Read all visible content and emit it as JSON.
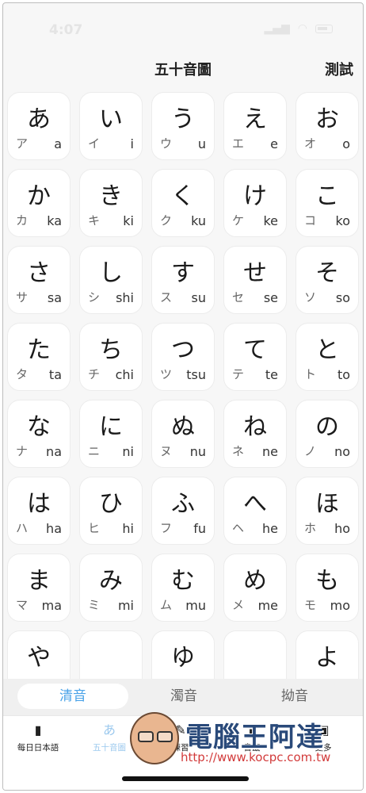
{
  "status_bar": {
    "time": "4:07"
  },
  "nav": {
    "title": "五十音圖",
    "test_button": "測試"
  },
  "kana_rows": [
    [
      {
        "hira": "あ",
        "kata": "ア",
        "roma": "a"
      },
      {
        "hira": "い",
        "kata": "イ",
        "roma": "i"
      },
      {
        "hira": "う",
        "kata": "ウ",
        "roma": "u"
      },
      {
        "hira": "え",
        "kata": "エ",
        "roma": "e"
      },
      {
        "hira": "お",
        "kata": "オ",
        "roma": "o"
      }
    ],
    [
      {
        "hira": "か",
        "kata": "カ",
        "roma": "ka"
      },
      {
        "hira": "き",
        "kata": "キ",
        "roma": "ki"
      },
      {
        "hira": "く",
        "kata": "ク",
        "roma": "ku"
      },
      {
        "hira": "け",
        "kata": "ケ",
        "roma": "ke"
      },
      {
        "hira": "こ",
        "kata": "コ",
        "roma": "ko"
      }
    ],
    [
      {
        "hira": "さ",
        "kata": "サ",
        "roma": "sa"
      },
      {
        "hira": "し",
        "kata": "シ",
        "roma": "shi"
      },
      {
        "hira": "す",
        "kata": "ス",
        "roma": "su"
      },
      {
        "hira": "せ",
        "kata": "セ",
        "roma": "se"
      },
      {
        "hira": "そ",
        "kata": "ソ",
        "roma": "so"
      }
    ],
    [
      {
        "hira": "た",
        "kata": "タ",
        "roma": "ta"
      },
      {
        "hira": "ち",
        "kata": "チ",
        "roma": "chi"
      },
      {
        "hira": "つ",
        "kata": "ツ",
        "roma": "tsu"
      },
      {
        "hira": "て",
        "kata": "テ",
        "roma": "te"
      },
      {
        "hira": "と",
        "kata": "ト",
        "roma": "to"
      }
    ],
    [
      {
        "hira": "な",
        "kata": "ナ",
        "roma": "na"
      },
      {
        "hira": "に",
        "kata": "ニ",
        "roma": "ni"
      },
      {
        "hira": "ぬ",
        "kata": "ヌ",
        "roma": "nu"
      },
      {
        "hira": "ね",
        "kata": "ネ",
        "roma": "ne"
      },
      {
        "hira": "の",
        "kata": "ノ",
        "roma": "no"
      }
    ],
    [
      {
        "hira": "は",
        "kata": "ハ",
        "roma": "ha"
      },
      {
        "hira": "ひ",
        "kata": "ヒ",
        "roma": "hi"
      },
      {
        "hira": "ふ",
        "kata": "フ",
        "roma": "fu"
      },
      {
        "hira": "へ",
        "kata": "ヘ",
        "roma": "he"
      },
      {
        "hira": "ほ",
        "kata": "ホ",
        "roma": "ho"
      }
    ],
    [
      {
        "hira": "ま",
        "kata": "マ",
        "roma": "ma"
      },
      {
        "hira": "み",
        "kata": "ミ",
        "roma": "mi"
      },
      {
        "hira": "む",
        "kata": "ム",
        "roma": "mu"
      },
      {
        "hira": "め",
        "kata": "メ",
        "roma": "me"
      },
      {
        "hira": "も",
        "kata": "モ",
        "roma": "mo"
      }
    ],
    [
      {
        "hira": "や",
        "kata": "",
        "roma": ""
      },
      {
        "hira": "",
        "kata": "",
        "roma": ""
      },
      {
        "hira": "ゆ",
        "kata": "",
        "roma": ""
      },
      {
        "hira": "",
        "kata": "",
        "roma": ""
      },
      {
        "hira": "よ",
        "kata": "",
        "roma": ""
      }
    ]
  ],
  "segments": [
    {
      "label": "清音",
      "active": true
    },
    {
      "label": "濁音",
      "active": false
    },
    {
      "label": "拗音",
      "active": false
    }
  ],
  "tabs": [
    {
      "label": "每日日本語",
      "icon": "calendar-icon",
      "glyph": "▮",
      "active": false
    },
    {
      "label": "五十音圖",
      "icon": "kana-icon",
      "glyph": "あ",
      "active": true
    },
    {
      "label": "練習",
      "icon": "practice-icon",
      "glyph": "✎",
      "active": false
    },
    {
      "label": "書籤",
      "icon": "bookmark-icon",
      "glyph": "▮",
      "active": false
    },
    {
      "label": "更多",
      "icon": "more-icon",
      "glyph": "▣",
      "active": false
    }
  ],
  "watermark": {
    "text": "電腦王阿達",
    "url": "http://www.kocpc.com.tw"
  },
  "colors": {
    "accent": "#4aa3e8",
    "tab_active": "#9cc9ee",
    "background": "#f7f7f7"
  }
}
